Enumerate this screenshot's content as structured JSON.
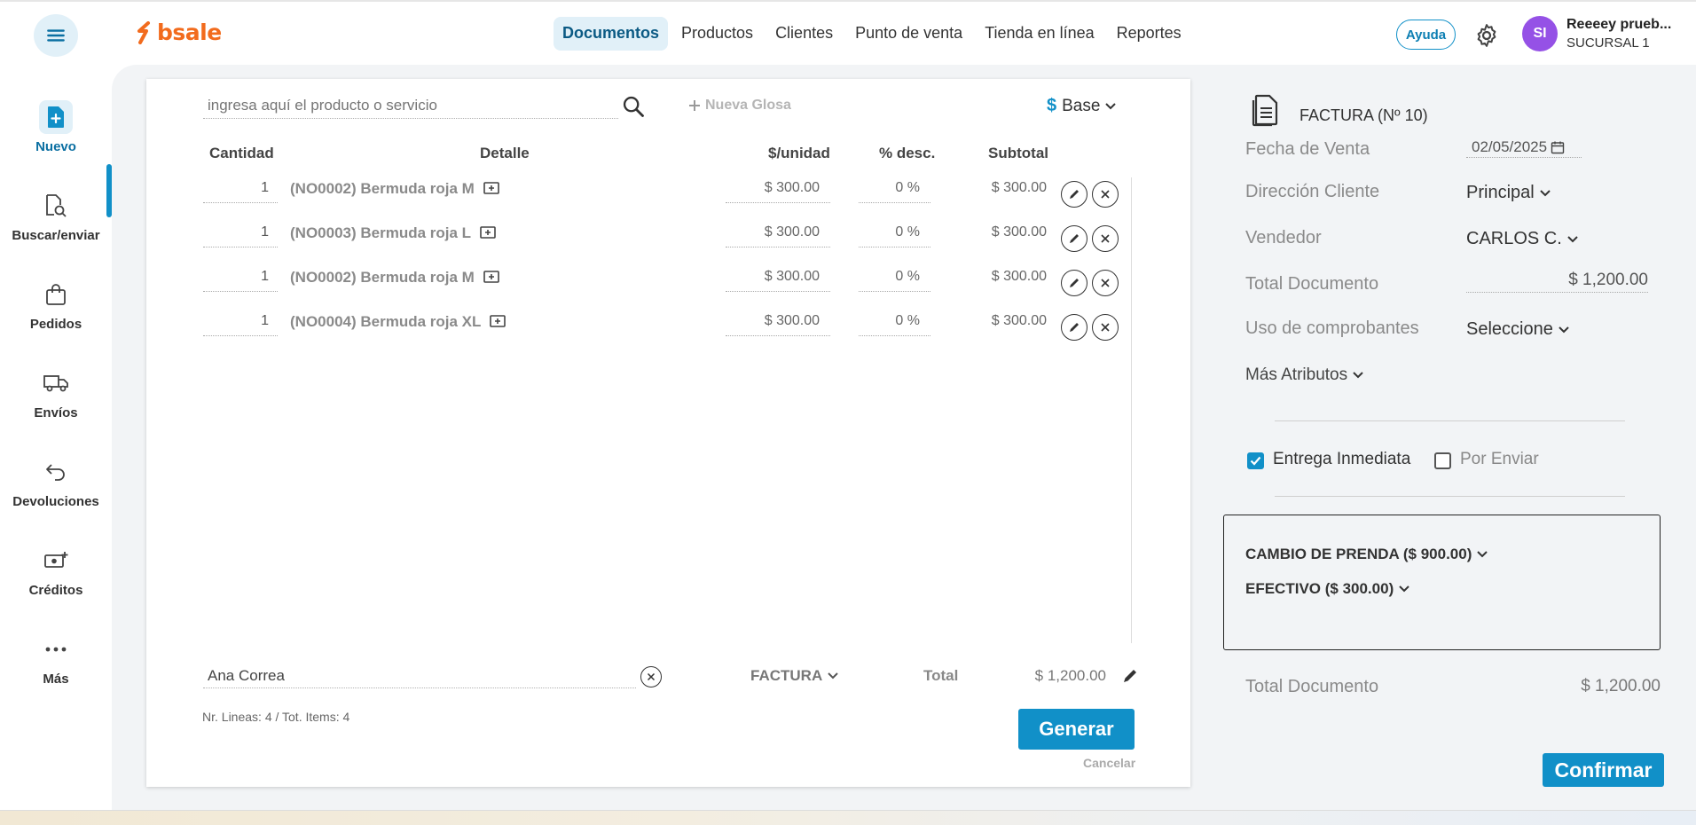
{
  "topbar": {
    "logo": "bsale",
    "nav": [
      "Documentos",
      "Productos",
      "Clientes",
      "Punto de venta",
      "Tienda en línea",
      "Reportes"
    ],
    "help": "Ayuda",
    "avatar_initials": "SI",
    "user_name": "Reeeey prueb...",
    "branch": "SUCURSAL 1"
  },
  "sidebar": {
    "items": [
      {
        "label": "Nuevo",
        "icon": "new-document-icon"
      },
      {
        "label": "Buscar/enviar",
        "icon": "search-document-icon"
      },
      {
        "label": "Pedidos",
        "icon": "shopping-bag-icon"
      },
      {
        "label": "Envíos",
        "icon": "truck-icon"
      },
      {
        "label": "Devoluciones",
        "icon": "return-arrow-icon"
      },
      {
        "label": "Créditos",
        "icon": "money-plus-icon"
      },
      {
        "label": "Más",
        "icon": "more-dots-icon"
      }
    ]
  },
  "editor": {
    "search_placeholder": "ingresa aquí el producto o servicio",
    "new_gloss": "Nueva Glosa",
    "price_list_symbol": "$",
    "price_list": "Base",
    "columns": {
      "qty": "Cantidad",
      "detail": "Detalle",
      "unit": "$/unidad",
      "disc": "% desc.",
      "subtotal": "Subtotal"
    },
    "lines": [
      {
        "qty": "1",
        "detail": "(NO0002) Bermuda roja M",
        "price": "$ 300.00",
        "disc": "0 %",
        "subtotal": "$ 300.00"
      },
      {
        "qty": "1",
        "detail": "(NO0003) Bermuda roja L",
        "price": "$ 300.00",
        "disc": "0 %",
        "subtotal": "$ 300.00"
      },
      {
        "qty": "1",
        "detail": "(NO0002) Bermuda roja M",
        "price": "$ 300.00",
        "disc": "0 %",
        "subtotal": "$ 300.00"
      },
      {
        "qty": "1",
        "detail": "(NO0004) Bermuda roja XL",
        "price": "$ 300.00",
        "disc": "0 %",
        "subtotal": "$ 300.00"
      }
    ],
    "client": "Ana Correa",
    "doc_type": "FACTURA",
    "total_label": "Total",
    "total_value": "$ 1,200.00",
    "counts": "Nr. Lineas: 4 / Tot. Items: 4",
    "generate": "Generar",
    "cancel": "Cancelar"
  },
  "panel": {
    "doc_title": "FACTURA (Nº 10)",
    "sale_date_label": "Fecha de Venta",
    "sale_date": "02/05/2025",
    "address_label": "Dirección Cliente",
    "address": "Principal",
    "seller_label": "Vendedor",
    "seller": "CARLOS C.",
    "total_doc_label": "Total Documento",
    "total_doc": "$ 1,200.00",
    "voucher_label": "Uso de comprobantes",
    "voucher": "Seleccione",
    "more_attributes": "Más Atributos",
    "immediate": "Entrega Inmediata",
    "immediate_checked": true,
    "to_send": "Por Enviar",
    "to_send_checked": false,
    "payments": [
      "CAMBIO DE PRENDA ($ 900.00)",
      "EFECTIVO ($ 300.00)"
    ],
    "grand_label": "Total Documento",
    "grand_value": "$ 1,200.00",
    "confirm": "Confirmar"
  },
  "colors": {
    "accent": "#1190c8",
    "brand": "#f26b1d",
    "avatar": "#9551e6"
  }
}
